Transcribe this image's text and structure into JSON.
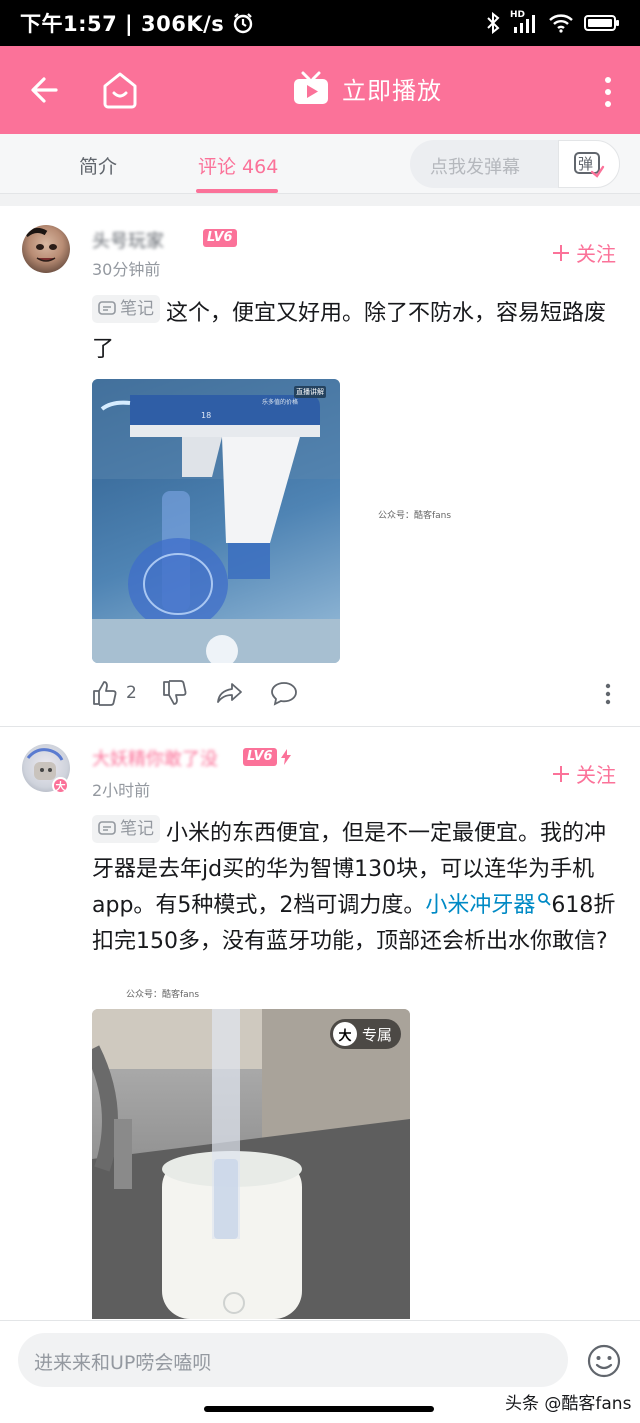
{
  "status_bar": {
    "time": "下午1:57",
    "speed": "306K/s",
    "hd": "HD"
  },
  "header": {
    "play_label": "立即播放"
  },
  "tabs": {
    "intro": "简介",
    "comments": "评论 464"
  },
  "danmaku": {
    "placeholder": "点我发弹幕",
    "button": "弹"
  },
  "comments": [
    {
      "username": "头号玩家",
      "level": "LV6",
      "time": "30分钟前",
      "follow": "关注",
      "note_tag": "笔记",
      "text": "这个，便宜又好用。除了不防水，容易短路废了",
      "image_watermark": "公众号：酷客fans",
      "image_badges": [
        "直播讲解",
        "乐多值的价格"
      ],
      "image_text": "18",
      "likes": "2"
    },
    {
      "username": "大妖精你敢了没",
      "level": "LV6",
      "time": "2小时前",
      "follow": "关注",
      "note_tag": "笔记",
      "text_before": "小米的东西便宜，但是不一定最便宜。我的冲牙器是去年jd买的华为智博130块，可以连华为手机app。有5种模式，2档可调力度。",
      "link": "小米冲牙器",
      "text_after": "618折扣完150多，没有蓝牙功能，顶部还会析出水你敢信?",
      "text_watermark": "公众号：酷客fans",
      "avatar_badge": "大",
      "image_badge": "专属",
      "image_badge_icon": "大"
    }
  ],
  "bottom_bar": {
    "placeholder": "进来来和UP唠会嗑呗",
    "credit": "头条 @酷客fans"
  },
  "colors": {
    "brand_pink": "#fb7299",
    "link_blue": "#008ac5",
    "muted_gray": "#9499a0"
  }
}
